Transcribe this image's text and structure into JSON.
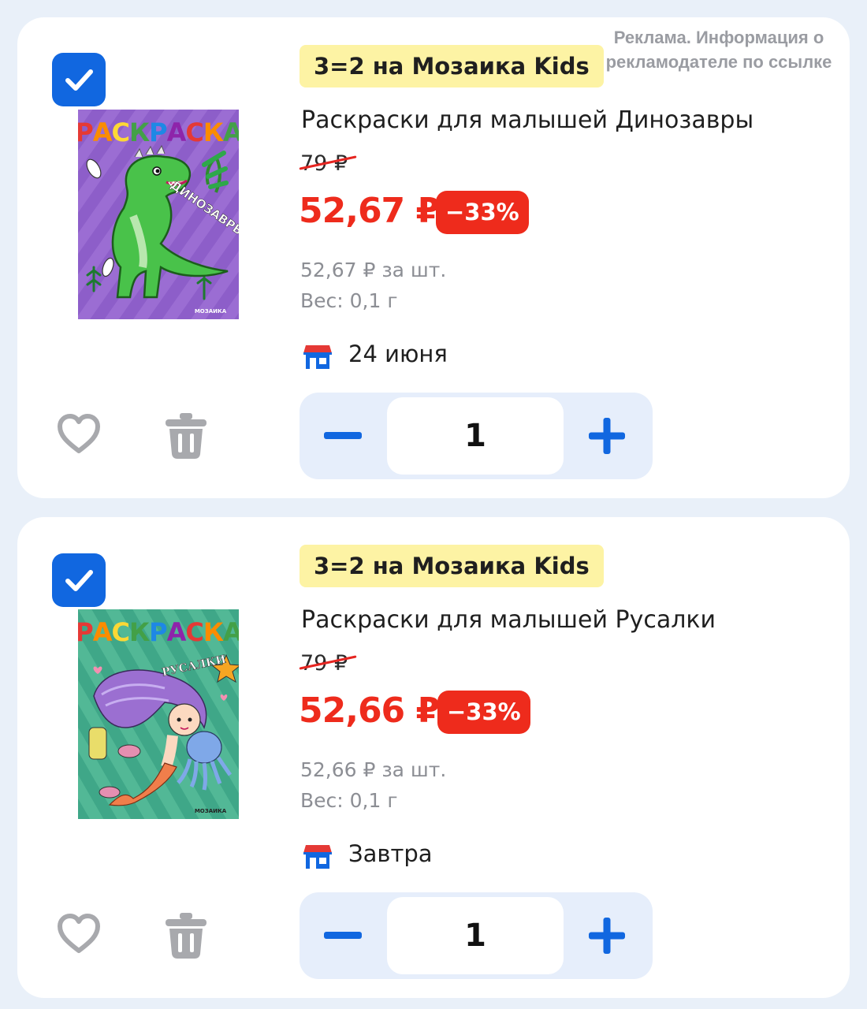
{
  "ad_notice": "Реклама. Информация о рекламодателе по ссылке",
  "colors": {
    "accent_blue": "#1167e0",
    "price_red": "#ee2b1c",
    "promo_yellow": "#fdf3a4",
    "background": "#e9f0f9"
  },
  "items": [
    {
      "checked": true,
      "promo": "3=2 на Мозаика Kids",
      "title": "Раскраски для малышей Динозавры",
      "old_price": "79 ₽",
      "price": "52,67 ₽",
      "discount": "−33%",
      "unit_price": "52,67 ₽ за шт.",
      "weight": "Вес: 0,1 г",
      "delivery": "24 июня",
      "quantity": "1",
      "cover": {
        "title": "РАСКРАСКА",
        "subtitle": "ДИНОЗАВРЫ",
        "publisher": "МОЗАИКА"
      }
    },
    {
      "checked": true,
      "promo": "3=2 на Мозаика Kids",
      "title": "Раскраски для малышей Русалки",
      "old_price": "79 ₽",
      "price": "52,66 ₽",
      "discount": "−33%",
      "unit_price": "52,66 ₽ за шт.",
      "weight": "Вес: 0,1 г",
      "delivery": "Завтра",
      "quantity": "1",
      "cover": {
        "title": "РАСКРАСКА",
        "subtitle": "РУСАЛКИ",
        "publisher": "МОЗАИКА"
      }
    }
  ],
  "icons": {
    "checkbox": "checkmark-icon",
    "delivery": "store-icon",
    "favorite": "heart-icon",
    "delete": "trash-icon",
    "decrease": "minus-icon",
    "increase": "plus-icon"
  }
}
